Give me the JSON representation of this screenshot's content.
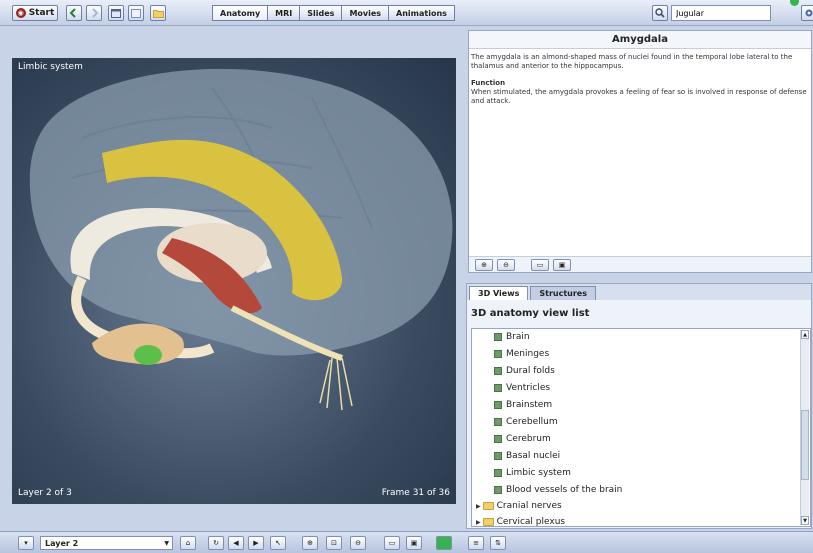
{
  "toolbar": {
    "start_label": "Start",
    "tabs": [
      {
        "label": "Anatomy"
      },
      {
        "label": "MRI"
      },
      {
        "label": "Slides"
      },
      {
        "label": "Movies"
      },
      {
        "label": "Animations"
      }
    ],
    "search": {
      "value": "Jugular"
    },
    "icons": [
      "back-arrow-icon",
      "forward-arrow-icon",
      "window-icon",
      "window-alt-icon",
      "folder-icon",
      "search-icon",
      "settings-icon",
      "help-icon"
    ]
  },
  "viewport": {
    "title": "Limbic system",
    "layer_text": "Layer 2 of 3",
    "frame_text": "Frame 31 of 36"
  },
  "info": {
    "title": "Amygdala",
    "description": "The amygdala is an almond-shaped mass of nuclei found in the temporal lobe lateral to the thalamus and anterior to the hippocampus.",
    "function_heading": "Function",
    "function_text": "When stimulated, the amygdala provokes a feeling of fear so is involved in response of defense and attack."
  },
  "lower": {
    "tabs": [
      {
        "label": "3D Views"
      },
      {
        "label": "Structures"
      }
    ],
    "heading": "3D anatomy view list",
    "items": [
      {
        "label": "Brain"
      },
      {
        "label": "Meninges"
      },
      {
        "label": "Dural folds"
      },
      {
        "label": "Ventricles"
      },
      {
        "label": "Brainstem"
      },
      {
        "label": "Cerebellum"
      },
      {
        "label": "Cerebrum"
      },
      {
        "label": "Basal nuclei"
      },
      {
        "label": "Limbic system"
      },
      {
        "label": "Blood vessels of the brain"
      }
    ],
    "folders": [
      {
        "label": "Cranial nerves"
      },
      {
        "label": "Cervical plexus"
      }
    ]
  },
  "bottom": {
    "layer_value": "Layer 2"
  },
  "colors": {
    "accent": "#6d80a8",
    "status_green": "#37b24d",
    "brain_grey": "#8a9cae",
    "fornix_yellow": "#d8c240"
  }
}
